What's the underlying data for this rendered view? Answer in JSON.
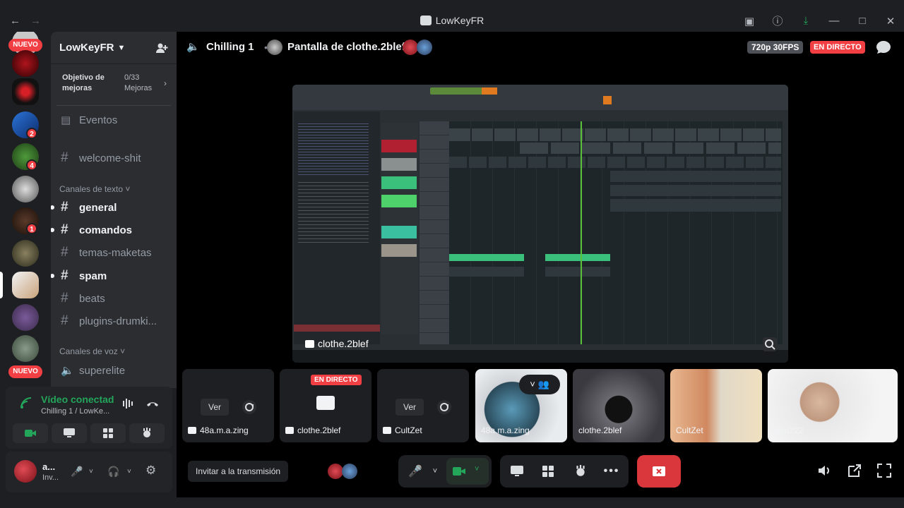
{
  "window": {
    "title": "LowKeyFR"
  },
  "server": {
    "name": "LowKeyFR",
    "boost": {
      "label": "Objetivo de mejoras",
      "progress": "0/33",
      "unit": "Mejoras"
    },
    "events": "Eventos",
    "channels_top": [
      {
        "name": "welcome-shit"
      }
    ],
    "text_category": "Canales de texto",
    "text_channels": [
      {
        "name": "general",
        "unread": true
      },
      {
        "name": "comandos",
        "unread": true
      },
      {
        "name": "temas-maketas",
        "unread": false
      },
      {
        "name": "spam",
        "unread": true
      },
      {
        "name": "beats",
        "unread": false
      },
      {
        "name": "plugins-drumki...",
        "unread": false
      }
    ],
    "voice_category": "Canales de voz",
    "voice_channels": [
      {
        "name": "superelite"
      }
    ]
  },
  "rail": {
    "nuevo_top": "NUEVO",
    "nuevo_bottom": "NUEVO",
    "badges": [
      "2",
      "4",
      "1"
    ]
  },
  "voice": {
    "status": "Vídeo conectado",
    "channel": "Chilling 1 / LowKe..."
  },
  "user": {
    "name": "a...",
    "status": "Inv..."
  },
  "stage": {
    "channel": "Chilling 1",
    "separator": "•",
    "sharing": "Pantalla de clothe.2blef",
    "quality": "720p 30FPS",
    "live": "EN DIRECTO",
    "stream_owner": "clothe.2blef"
  },
  "tiles": [
    {
      "name": "48a.m.a.zing",
      "view": "Ver",
      "type": "stream-off"
    },
    {
      "name": "clothe.2blef",
      "badge": "EN DIRECTO",
      "type": "stream-live"
    },
    {
      "name": "CultZet",
      "view": "Ver",
      "type": "stream-off"
    },
    {
      "name": "48a.m.a.zing",
      "type": "camera"
    },
    {
      "name": "clothe.2blef",
      "type": "camera"
    },
    {
      "name": "CultZet",
      "type": "camera"
    },
    {
      "name": "akta222",
      "type": "camera"
    }
  ],
  "controls": {
    "invite": "Invitar a la transmisión"
  },
  "colors": {
    "live_red": "#f23f43",
    "connected_green": "#23a55a",
    "end_call": "#da373c"
  }
}
